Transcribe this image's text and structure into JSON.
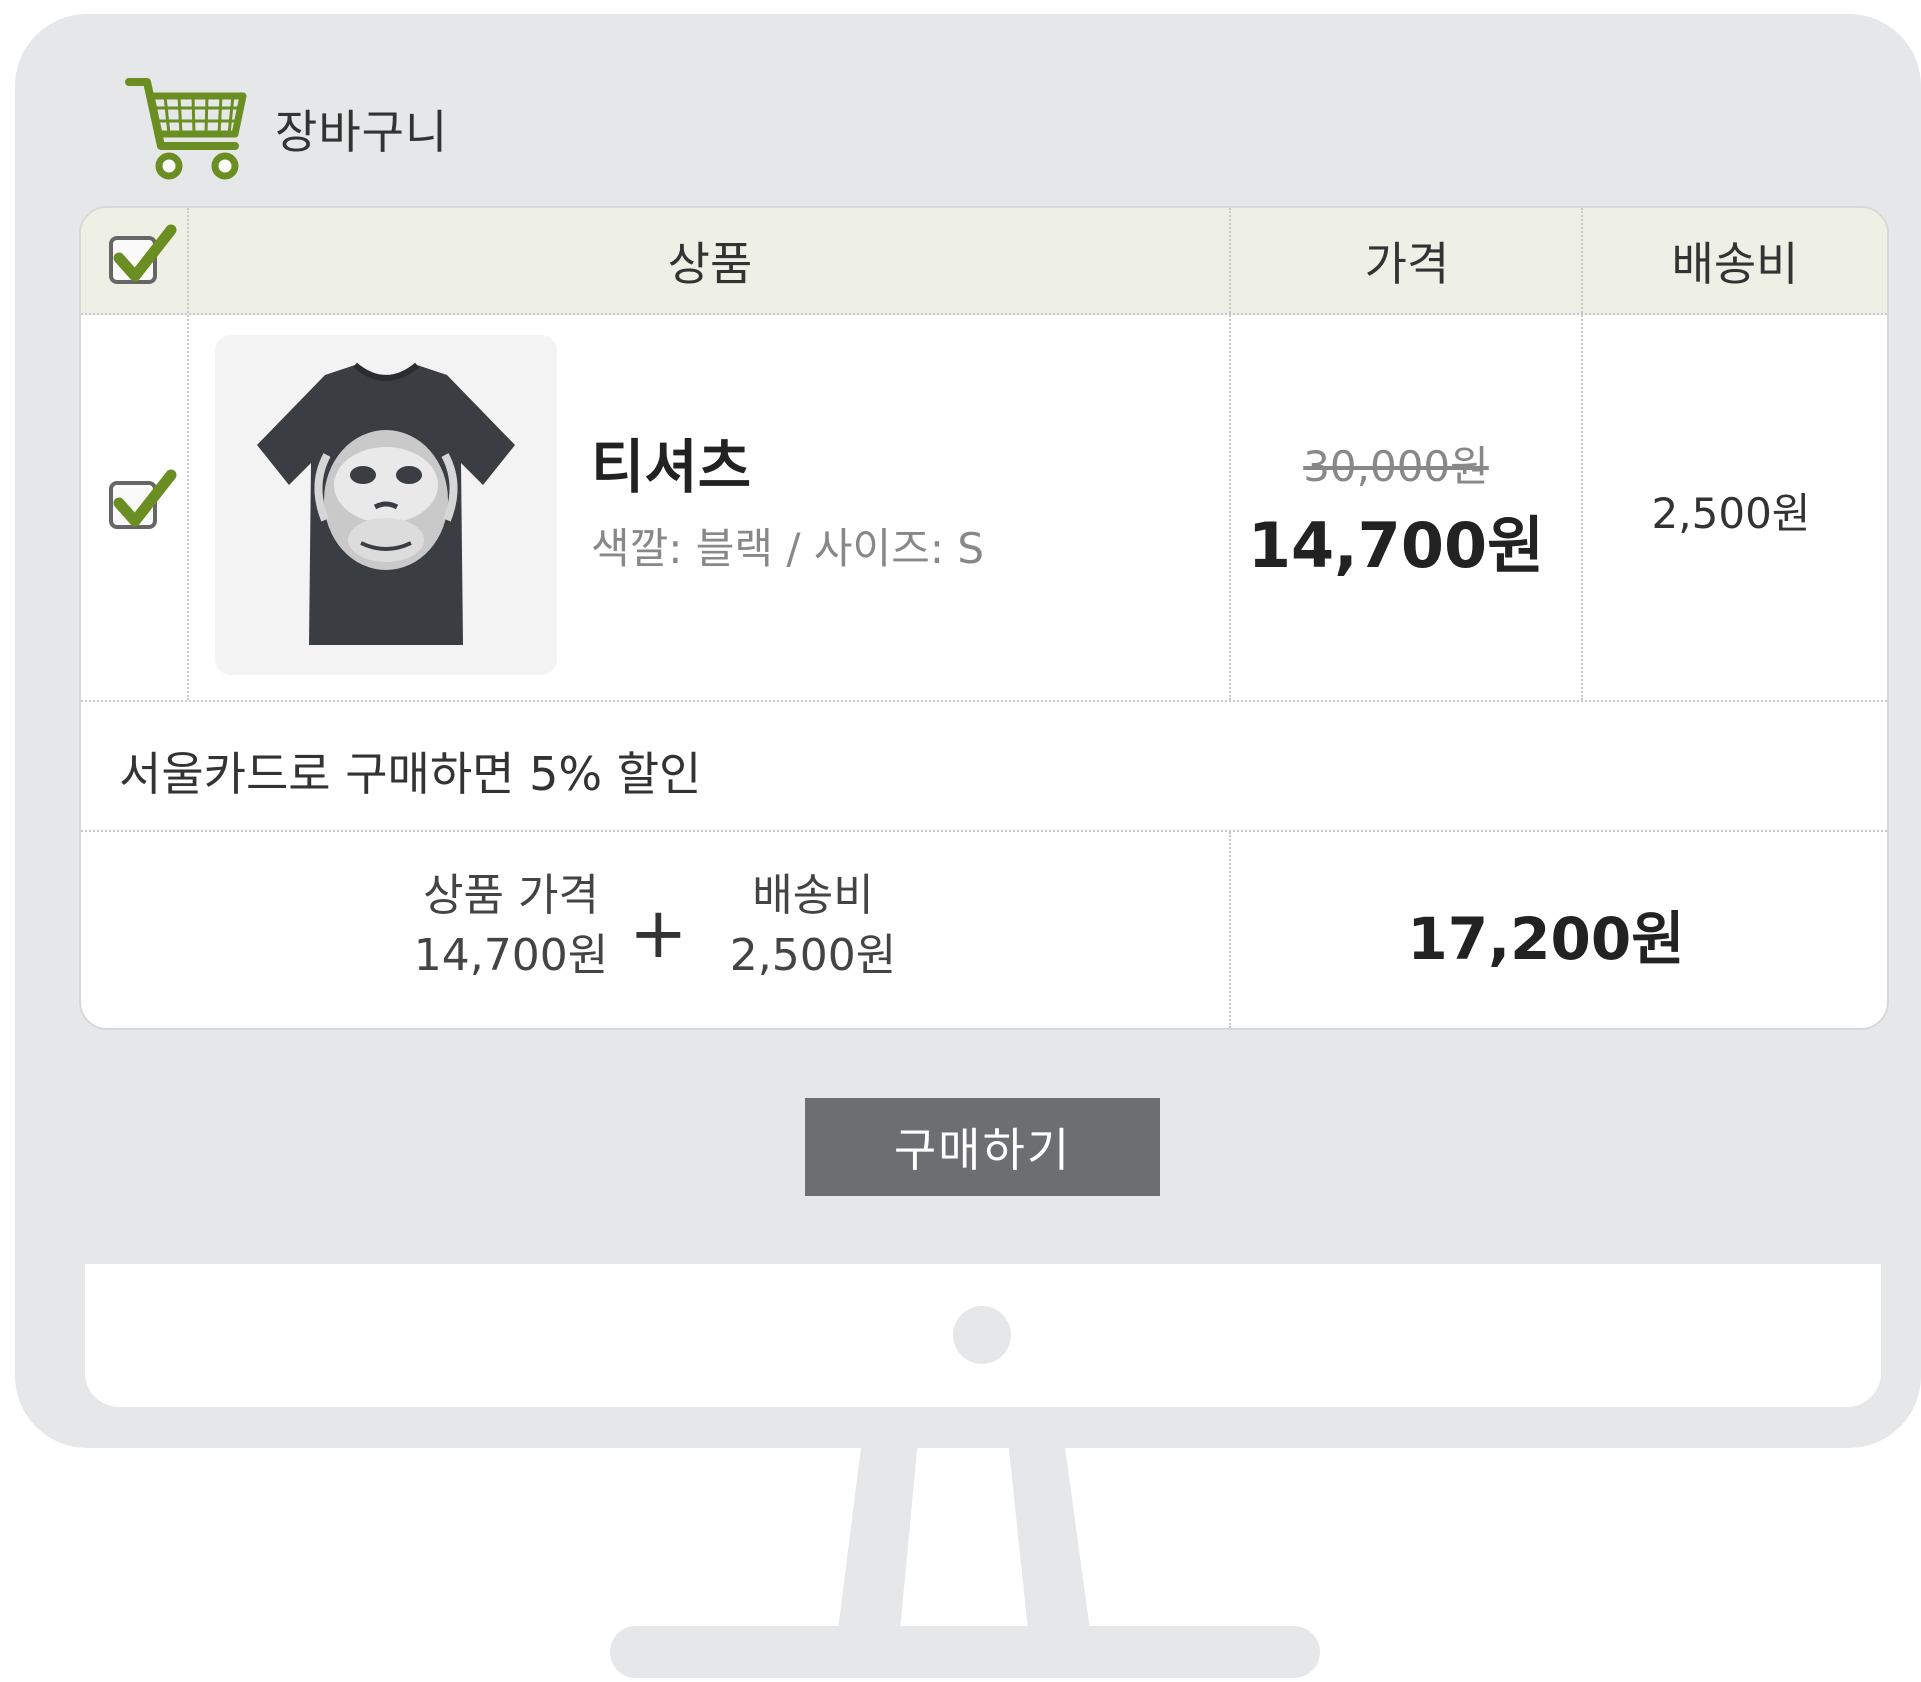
{
  "cart": {
    "title": "장바구니"
  },
  "table": {
    "headers": {
      "product": "상품",
      "price": "가격",
      "shipping": "배송비"
    },
    "select_all_checked": true
  },
  "item": {
    "checked": true,
    "name": "티셔츠",
    "option": "색깔: 블랙 / 사이즈: S",
    "original_price": "30,000원",
    "sale_price": "14,700원",
    "shipping": "2,500원",
    "image_icon": "tshirt-image"
  },
  "promo": {
    "text": "서울카드로 구매하면 5% 할인"
  },
  "summary": {
    "product_price_label": "상품 가격",
    "product_price_value": "14,700원",
    "plus_sign": "+",
    "shipping_label": "배송비",
    "shipping_value": "2,500원",
    "total": "17,200원"
  },
  "actions": {
    "buy_label": "구매하기"
  },
  "colors": {
    "accent_green": "#6b8e23",
    "header_bg": "#eef0e6",
    "button_bg": "#6d6e71",
    "monitor_frame": "#e6e7e8"
  }
}
